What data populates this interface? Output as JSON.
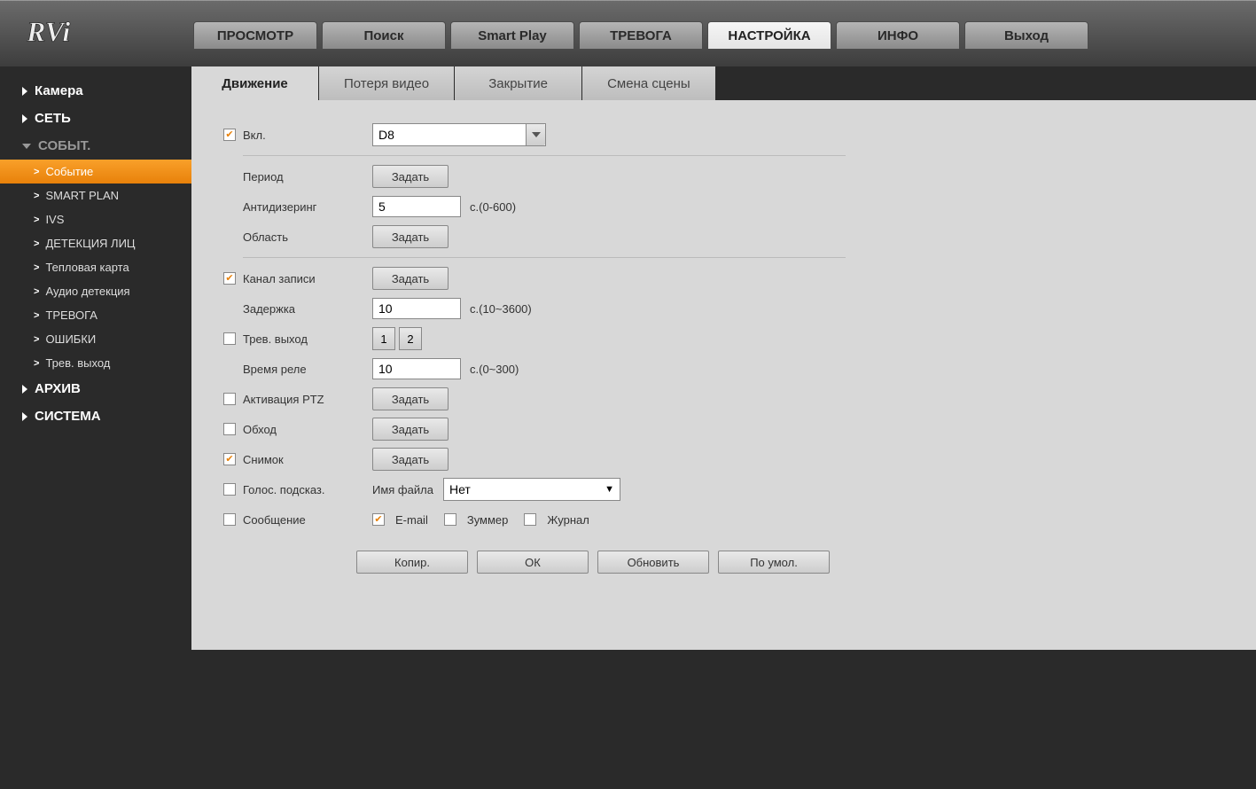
{
  "logo": "RVi",
  "topnav": [
    {
      "label": "ПРОСМОТР",
      "active": false
    },
    {
      "label": "Поиск",
      "active": false
    },
    {
      "label": "Smart Play",
      "active": false
    },
    {
      "label": "ТРЕВОГА",
      "active": false
    },
    {
      "label": "НАСТРОЙКА",
      "active": true
    },
    {
      "label": "ИНФО",
      "active": false
    },
    {
      "label": "Выход",
      "active": false
    }
  ],
  "sidebar": {
    "camera": "Камера",
    "network": "СЕТЬ",
    "events": "СОБЫТ.",
    "event_items": [
      {
        "label": "Событие",
        "active": true
      },
      {
        "label": "SMART PLAN",
        "active": false
      },
      {
        "label": "IVS",
        "active": false
      },
      {
        "label": "ДЕТЕКЦИЯ ЛИЦ",
        "active": false
      },
      {
        "label": "Тепловая карта",
        "active": false
      },
      {
        "label": "Аудио детекция",
        "active": false
      },
      {
        "label": "ТРЕВОГА",
        "active": false
      },
      {
        "label": "ОШИБКИ",
        "active": false
      },
      {
        "label": "Трев. выход",
        "active": false
      }
    ],
    "archive": "АРХИВ",
    "system": "СИСТЕМА"
  },
  "tabs": [
    {
      "label": "Движение",
      "active": true
    },
    {
      "label": "Потеря видео",
      "active": false
    },
    {
      "label": "Закрытие",
      "active": false
    },
    {
      "label": "Смена сцены",
      "active": false
    }
  ],
  "form": {
    "enable_label": "Вкл.",
    "channel_value": "D8",
    "period_label": "Период",
    "set_button": "Задать",
    "antidither_label": "Антидизеринг",
    "antidither_value": "5",
    "antidither_suffix": "с.(0-600)",
    "area_label": "Область",
    "record_channel_label": "Канал записи",
    "delay_label": "Задержка",
    "delay_value": "10",
    "delay_suffix": "с.(10~3600)",
    "alarm_out_label": "Трев. выход",
    "alarm_out_1": "1",
    "alarm_out_2": "2",
    "relay_time_label": "Время реле",
    "relay_time_value": "10",
    "relay_time_suffix": "с.(0~300)",
    "ptz_label": "Активация PTZ",
    "tour_label": "Обход",
    "snapshot_label": "Снимок",
    "voice_label": "Голос. подсказ.",
    "filename_label": "Имя файла",
    "filename_value": "Нет",
    "message_label": "Сообщение",
    "email_label": "E-mail",
    "buzzer_label": "Зуммер",
    "log_label": "Журнал",
    "copy_btn": "Копир.",
    "ok_btn": "ОК",
    "refresh_btn": "Обновить",
    "default_btn": "По умол."
  }
}
